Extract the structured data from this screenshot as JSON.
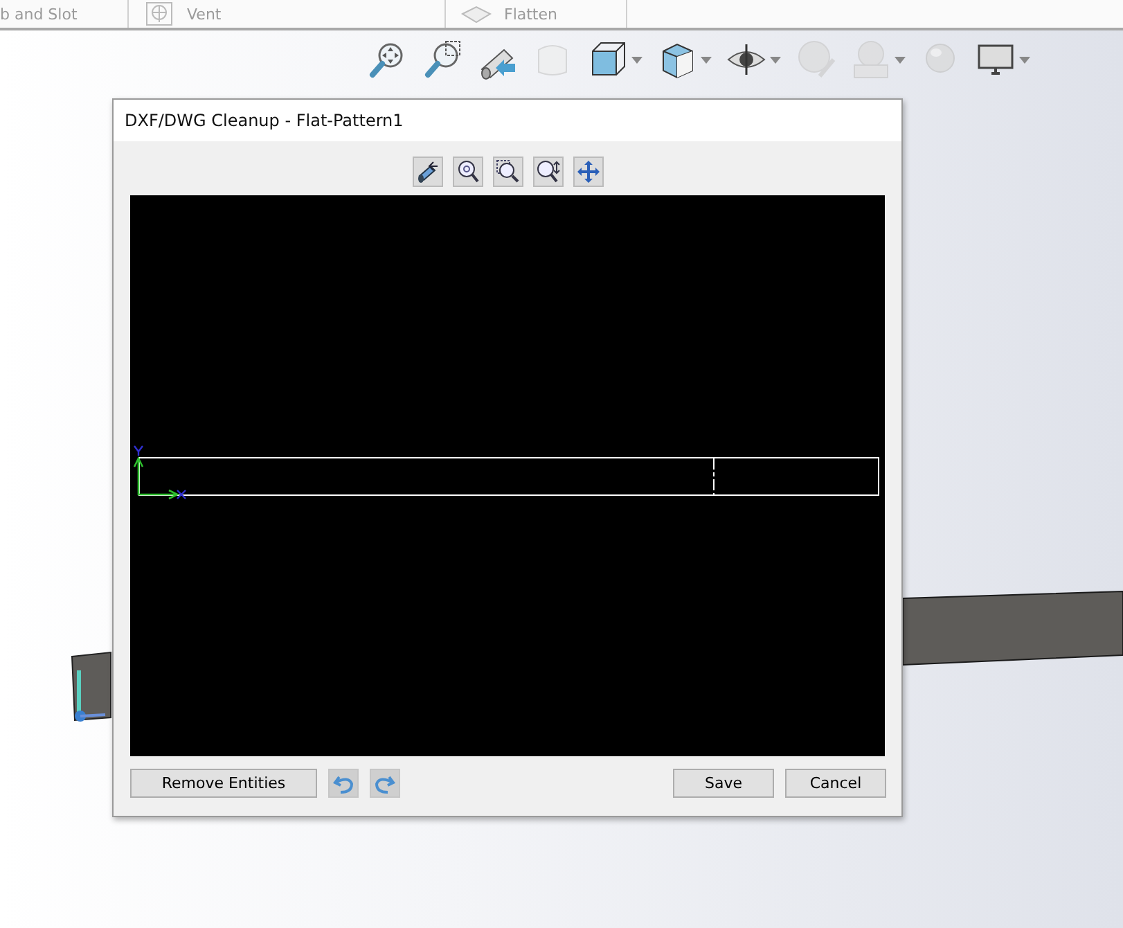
{
  "ribbon": {
    "items": [
      {
        "label": "b and Slot",
        "kind": "plain"
      },
      {
        "label": "Vent",
        "kind": "vent"
      },
      {
        "label": "Flatten",
        "kind": "flatten"
      }
    ]
  },
  "view_toolbar": {
    "items": [
      {
        "kind": "zoom-fit",
        "disabled": false,
        "menu": false
      },
      {
        "kind": "zoom-area",
        "disabled": false,
        "menu": false
      },
      {
        "kind": "previous-view",
        "disabled": false,
        "menu": false
      },
      {
        "kind": "section",
        "disabled": true,
        "menu": false
      },
      {
        "kind": "orientation",
        "disabled": false,
        "menu": true
      },
      {
        "kind": "display-style",
        "disabled": false,
        "menu": true
      },
      {
        "kind": "visibility",
        "disabled": false,
        "menu": true
      },
      {
        "kind": "appearance",
        "disabled": true,
        "menu": false
      },
      {
        "kind": "scene",
        "disabled": true,
        "menu": true
      },
      {
        "kind": "lights",
        "disabled": true,
        "menu": false
      },
      {
        "kind": "monitor",
        "disabled": false,
        "menu": true
      }
    ]
  },
  "dialog": {
    "title": "DXF/DWG Cleanup - Flat-Pattern1",
    "tools": [
      {
        "kind": "previous-view"
      },
      {
        "kind": "zoom-fit"
      },
      {
        "kind": "zoom-area"
      },
      {
        "kind": "zoom-in-out"
      },
      {
        "kind": "pan"
      }
    ],
    "left_actions": [
      {
        "kind": "text",
        "label": "Remove Entities"
      },
      {
        "kind": "undo"
      },
      {
        "kind": "redo"
      }
    ],
    "right_actions": [
      {
        "kind": "text",
        "label": "Save"
      },
      {
        "kind": "text",
        "label": "Cancel"
      }
    ]
  }
}
